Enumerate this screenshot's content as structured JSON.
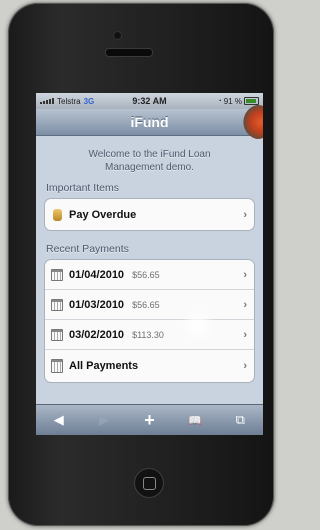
{
  "statusbar": {
    "carrier": "Telstra",
    "network": "3G",
    "time": "9:32 AM",
    "battery": "91 %"
  },
  "navbar": {
    "title": "iFund"
  },
  "welcome": {
    "line1": "Welcome to the iFund Loan",
    "line2": "Management demo."
  },
  "important": {
    "heading": "Important Items",
    "items": [
      {
        "label": "Pay Overdue",
        "icon": "coin-icon"
      }
    ]
  },
  "recent": {
    "heading": "Recent Payments",
    "items": [
      {
        "date": "01/04/2010",
        "amount": "$56.65",
        "icon": "calendar-icon"
      },
      {
        "date": "01/03/2010",
        "amount": "$56.65",
        "icon": "calendar-icon"
      },
      {
        "date": "03/02/2010",
        "amount": "$113.30",
        "icon": "calendar-icon"
      }
    ],
    "all_label": "All Payments"
  },
  "toolbar": {
    "back": "◀",
    "forward": "▶",
    "add": "+",
    "bookmarks": "📖",
    "pages": "⧉"
  },
  "chevron": "›"
}
